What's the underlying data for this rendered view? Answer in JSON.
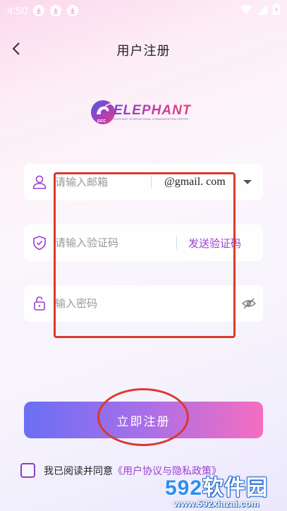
{
  "status_bar": {
    "time": "4:50"
  },
  "nav": {
    "title": "用户注册"
  },
  "logo": {
    "text": "ELEPHANT",
    "subtitle": "ELEPHANT INTERNATIONAL COMMUNICATION CENTER",
    "badge": "EICC"
  },
  "form": {
    "email": {
      "placeholder": "请输入邮箱",
      "domain": "@gmail. com"
    },
    "code": {
      "placeholder": "请输入验证码",
      "send_label": "发送验证码"
    },
    "password": {
      "placeholder": "输入密码"
    }
  },
  "register_button": {
    "label": "立即注册"
  },
  "agreement": {
    "text": "我已阅读并同意",
    "link": "《用户协议与隐私政策》"
  },
  "watermark": {
    "main_num": "592",
    "main_text": "软件园",
    "url": "www.592xiazai.com"
  },
  "colors": {
    "accent": "#9b3fd0",
    "annotation": "#d93a2e",
    "button_start": "#6a6ff5",
    "button_end": "#f56ec0"
  }
}
